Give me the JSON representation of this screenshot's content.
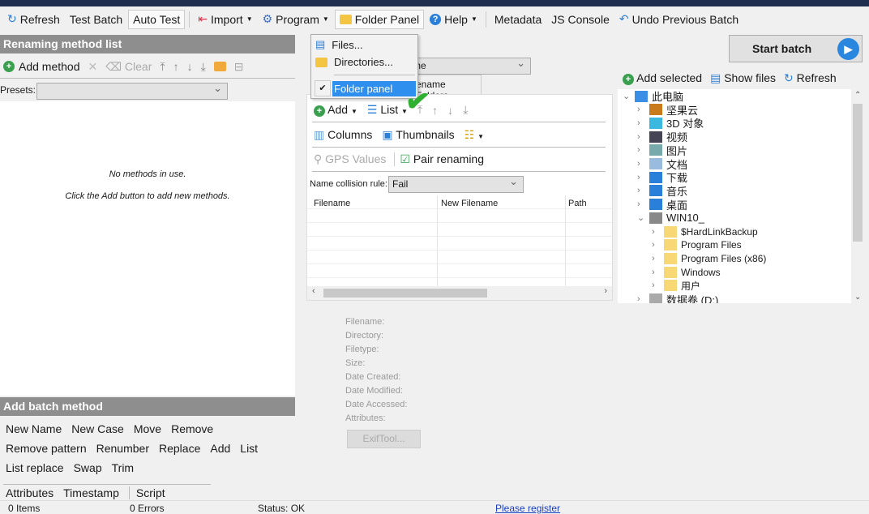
{
  "toolbar": {
    "refresh": "Refresh",
    "test_batch": "Test Batch",
    "auto_test": "Auto Test",
    "import": "Import",
    "program": "Program",
    "folder_panel": "Folder Panel",
    "help": "Help",
    "metadata": "Metadata",
    "js_console": "JS Console",
    "undo": "Undo Previous Batch"
  },
  "folder_menu": {
    "items": [
      "Files...",
      "Directories..."
    ],
    "checked_item": "Folder panel"
  },
  "left": {
    "header": "Renaming method list",
    "add_method": "Add method",
    "clear": "Clear",
    "presets_label": "Presets:",
    "presets_value": "",
    "empty_line1": "No methods in use.",
    "empty_line2": "Click the Add button to add new methods."
  },
  "batch": {
    "header": "Add batch method",
    "rows": [
      [
        "New Name",
        "New Case",
        "Move",
        "Remove"
      ],
      [
        "Remove pattern",
        "Renumber",
        "Replace",
        "Add",
        "List"
      ],
      [
        "List replace",
        "Swap",
        "Trim"
      ]
    ],
    "tabs": [
      "Attributes",
      "Timestamp",
      "Script"
    ]
  },
  "middle": {
    "combo_value": "ename",
    "tab_partial": "ename Folders",
    "add": "Add",
    "list": "List",
    "columns": "Columns",
    "thumbnails": "Thumbnails",
    "gps": "GPS Values",
    "pair": "Pair renaming",
    "collision_label": "Name collision rule:",
    "collision_value": "Fail",
    "columns_headers": [
      "Filename",
      "New Filename",
      "Path"
    ]
  },
  "details": {
    "labels": [
      "Filename:",
      "Directory:",
      "Filetype:",
      "Size:",
      "Date Created:",
      "Date Modified:",
      "Date Accessed:",
      "Attributes:"
    ],
    "exiftool": "ExifTool..."
  },
  "right": {
    "start_batch": "Start batch",
    "add_selected": "Add selected",
    "show_files": "Show files",
    "refresh": "Refresh",
    "tree": [
      {
        "label": "此电脑",
        "level": 0,
        "open": true
      },
      {
        "label": "坚果云",
        "level": 1
      },
      {
        "label": "3D 对象",
        "level": 1
      },
      {
        "label": "视频",
        "level": 1
      },
      {
        "label": "图片",
        "level": 1
      },
      {
        "label": "文档",
        "level": 1
      },
      {
        "label": "下载",
        "level": 1
      },
      {
        "label": "音乐",
        "level": 1
      },
      {
        "label": "桌面",
        "level": 1
      },
      {
        "label": "WIN10_",
        "level": 1,
        "open": true
      },
      {
        "label": "$HardLinkBackup",
        "level": 2
      },
      {
        "label": "Program Files",
        "level": 2
      },
      {
        "label": "Program Files (x86)",
        "level": 2
      },
      {
        "label": "Windows",
        "level": 2
      },
      {
        "label": "用户",
        "level": 2
      },
      {
        "label": "数据卷 (D:)",
        "level": 1
      }
    ]
  },
  "status": {
    "items": "0 Items",
    "errors": "0 Errors",
    "status": "Status: OK",
    "register": "Please register"
  },
  "colors": {
    "accent": "#2a7fd8",
    "header": "#8e8e8e",
    "selection": "#2f8fef",
    "check": "#2fb030"
  }
}
